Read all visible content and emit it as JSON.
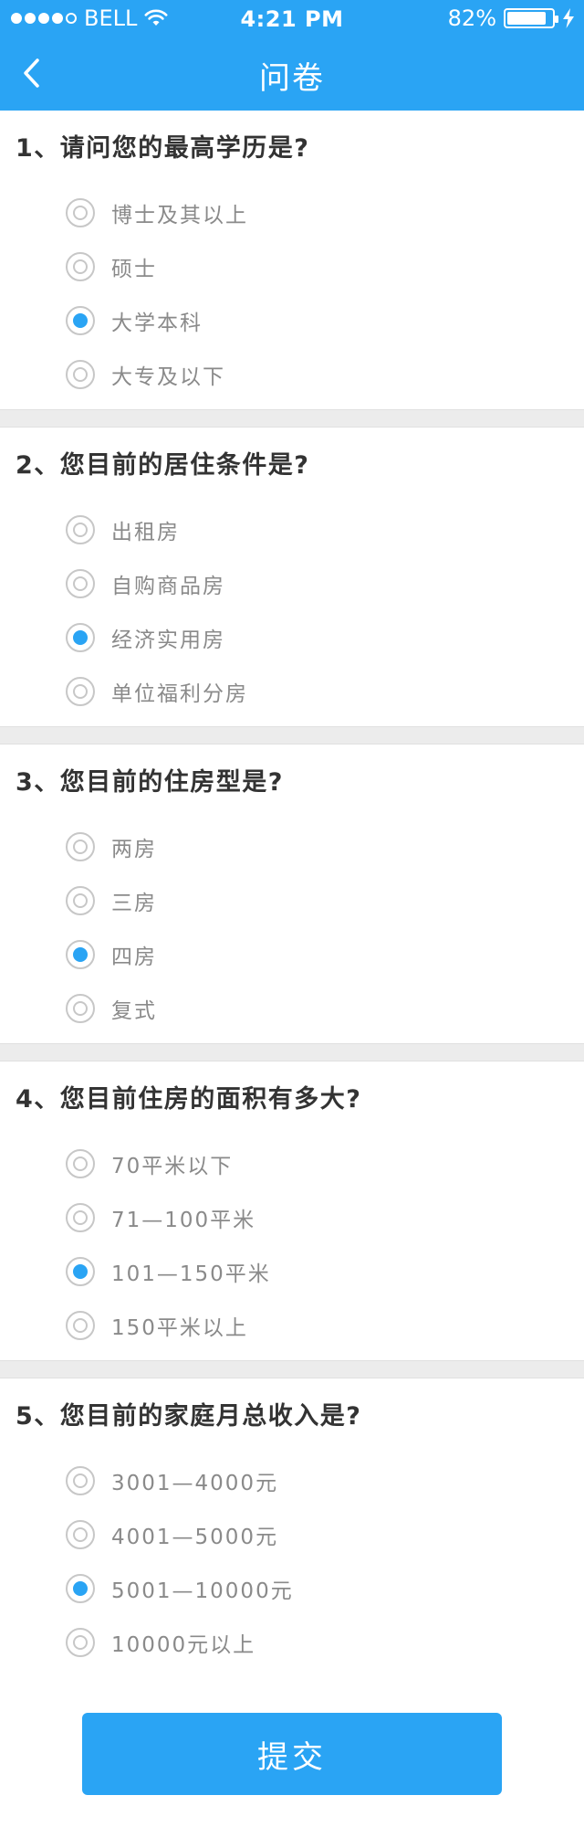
{
  "status_bar": {
    "carrier": "BELL",
    "time": "4:21 PM",
    "battery": "82%"
  },
  "nav": {
    "title": "问卷",
    "back_icon": "chevron-left-icon"
  },
  "questions": [
    {
      "title": "1、请问您的最高学历是?",
      "options": [
        "博士及其以上",
        "硕士",
        "大学本科",
        "大专及以下"
      ],
      "selected_index": 2
    },
    {
      "title": "2、您目前的居住条件是?",
      "options": [
        "出租房",
        "自购商品房",
        "经济实用房",
        "单位福利分房"
      ],
      "selected_index": 2
    },
    {
      "title": "3、您目前的住房型是?",
      "options": [
        "两房",
        "三房",
        "四房",
        "复式"
      ],
      "selected_index": 2
    },
    {
      "title": "4、您目前住房的面积有多大?",
      "options": [
        "70平米以下",
        "71—100平米",
        "101—150平米",
        "150平米以上"
      ],
      "selected_index": 2
    },
    {
      "title": "5、您目前的家庭月总收入是?",
      "options": [
        "3001—4000元",
        "4001—5000元",
        "5001—10000元",
        "10000元以上"
      ],
      "selected_index": 2
    }
  ],
  "submit_label": "提交",
  "colors": {
    "accent": "#2aa4f4",
    "divider": "#ececec",
    "option_text": "#8a8a8a",
    "title_text": "#333333"
  }
}
